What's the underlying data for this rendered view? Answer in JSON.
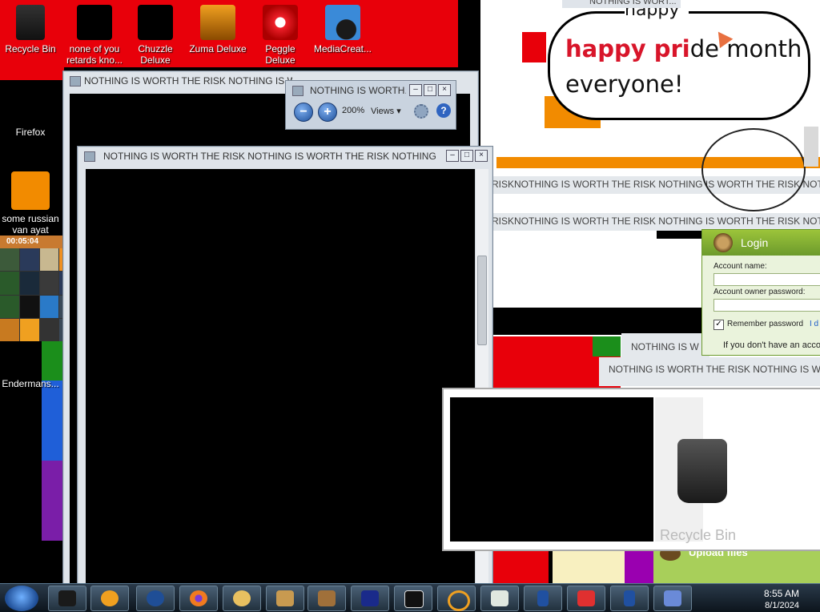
{
  "desktop": {
    "icons": [
      {
        "label": "Recycle Bin"
      },
      {
        "label": "none of you retards kno..."
      },
      {
        "label": "Chuzzle Deluxe"
      },
      {
        "label": "Zuma Deluxe"
      },
      {
        "label": "Peggle Deluxe"
      },
      {
        "label": "MediaCreat..."
      },
      {
        "label": "Firefox"
      },
      {
        "label": "some russian van ayat"
      },
      {
        "label": "Endermans..."
      }
    ],
    "bubble": {
      "top_text": "happy",
      "line1_red": "happy pri",
      "line1_rest": "de month",
      "line2": "everyone!"
    }
  },
  "windows": {
    "title_text": "NOTHING IS WORTH THE RISK NOTHING IS W...",
    "top_cut_title": "NOTHING IS WORT...",
    "photo_viewer": {
      "title": "NOTHING IS WORTH...",
      "zoom": "200%",
      "views": "Views ▾"
    },
    "main_title": "NOTHING IS WORTH THE RISK NOTHING IS WORTH THE RISK NOTHING IS W...",
    "strip1": "RISKNOTHING IS WORTH THE RISK NOTHING IS WORTH THE RISK NOTHING",
    "strip2": "RISKNOTHING IS WORTH THE RISK NOTHING IS WORTH THE RISK NOTHING I",
    "strip3": "NOTHING IS W",
    "strip4": "NOTHING IS WORTH THE RISK NOTHING IS WORT",
    "preview_label": "Recycle Bin"
  },
  "game": {
    "time": "00:05:04"
  },
  "login": {
    "title": "Login",
    "account_label": "Account name:",
    "password_label": "Account owner password:",
    "remember": "Remember password",
    "link": "I d",
    "info": "If you don't have an acco"
  },
  "upload": {
    "label": "Upload files"
  },
  "taskbar": {
    "time": "8:55 AM",
    "date": "8/1/2024",
    "items": [
      "start-button",
      "media-player",
      "windows-media",
      "firefox",
      "chuzzle",
      "box",
      "uploader",
      "mci",
      "screen",
      "search",
      "file",
      "phone",
      "arrow-app",
      "phone2",
      "network"
    ]
  },
  "colors": {
    "accent_red": "#e8000a",
    "orange": "#f28b00",
    "green": "#6c9a2c"
  }
}
